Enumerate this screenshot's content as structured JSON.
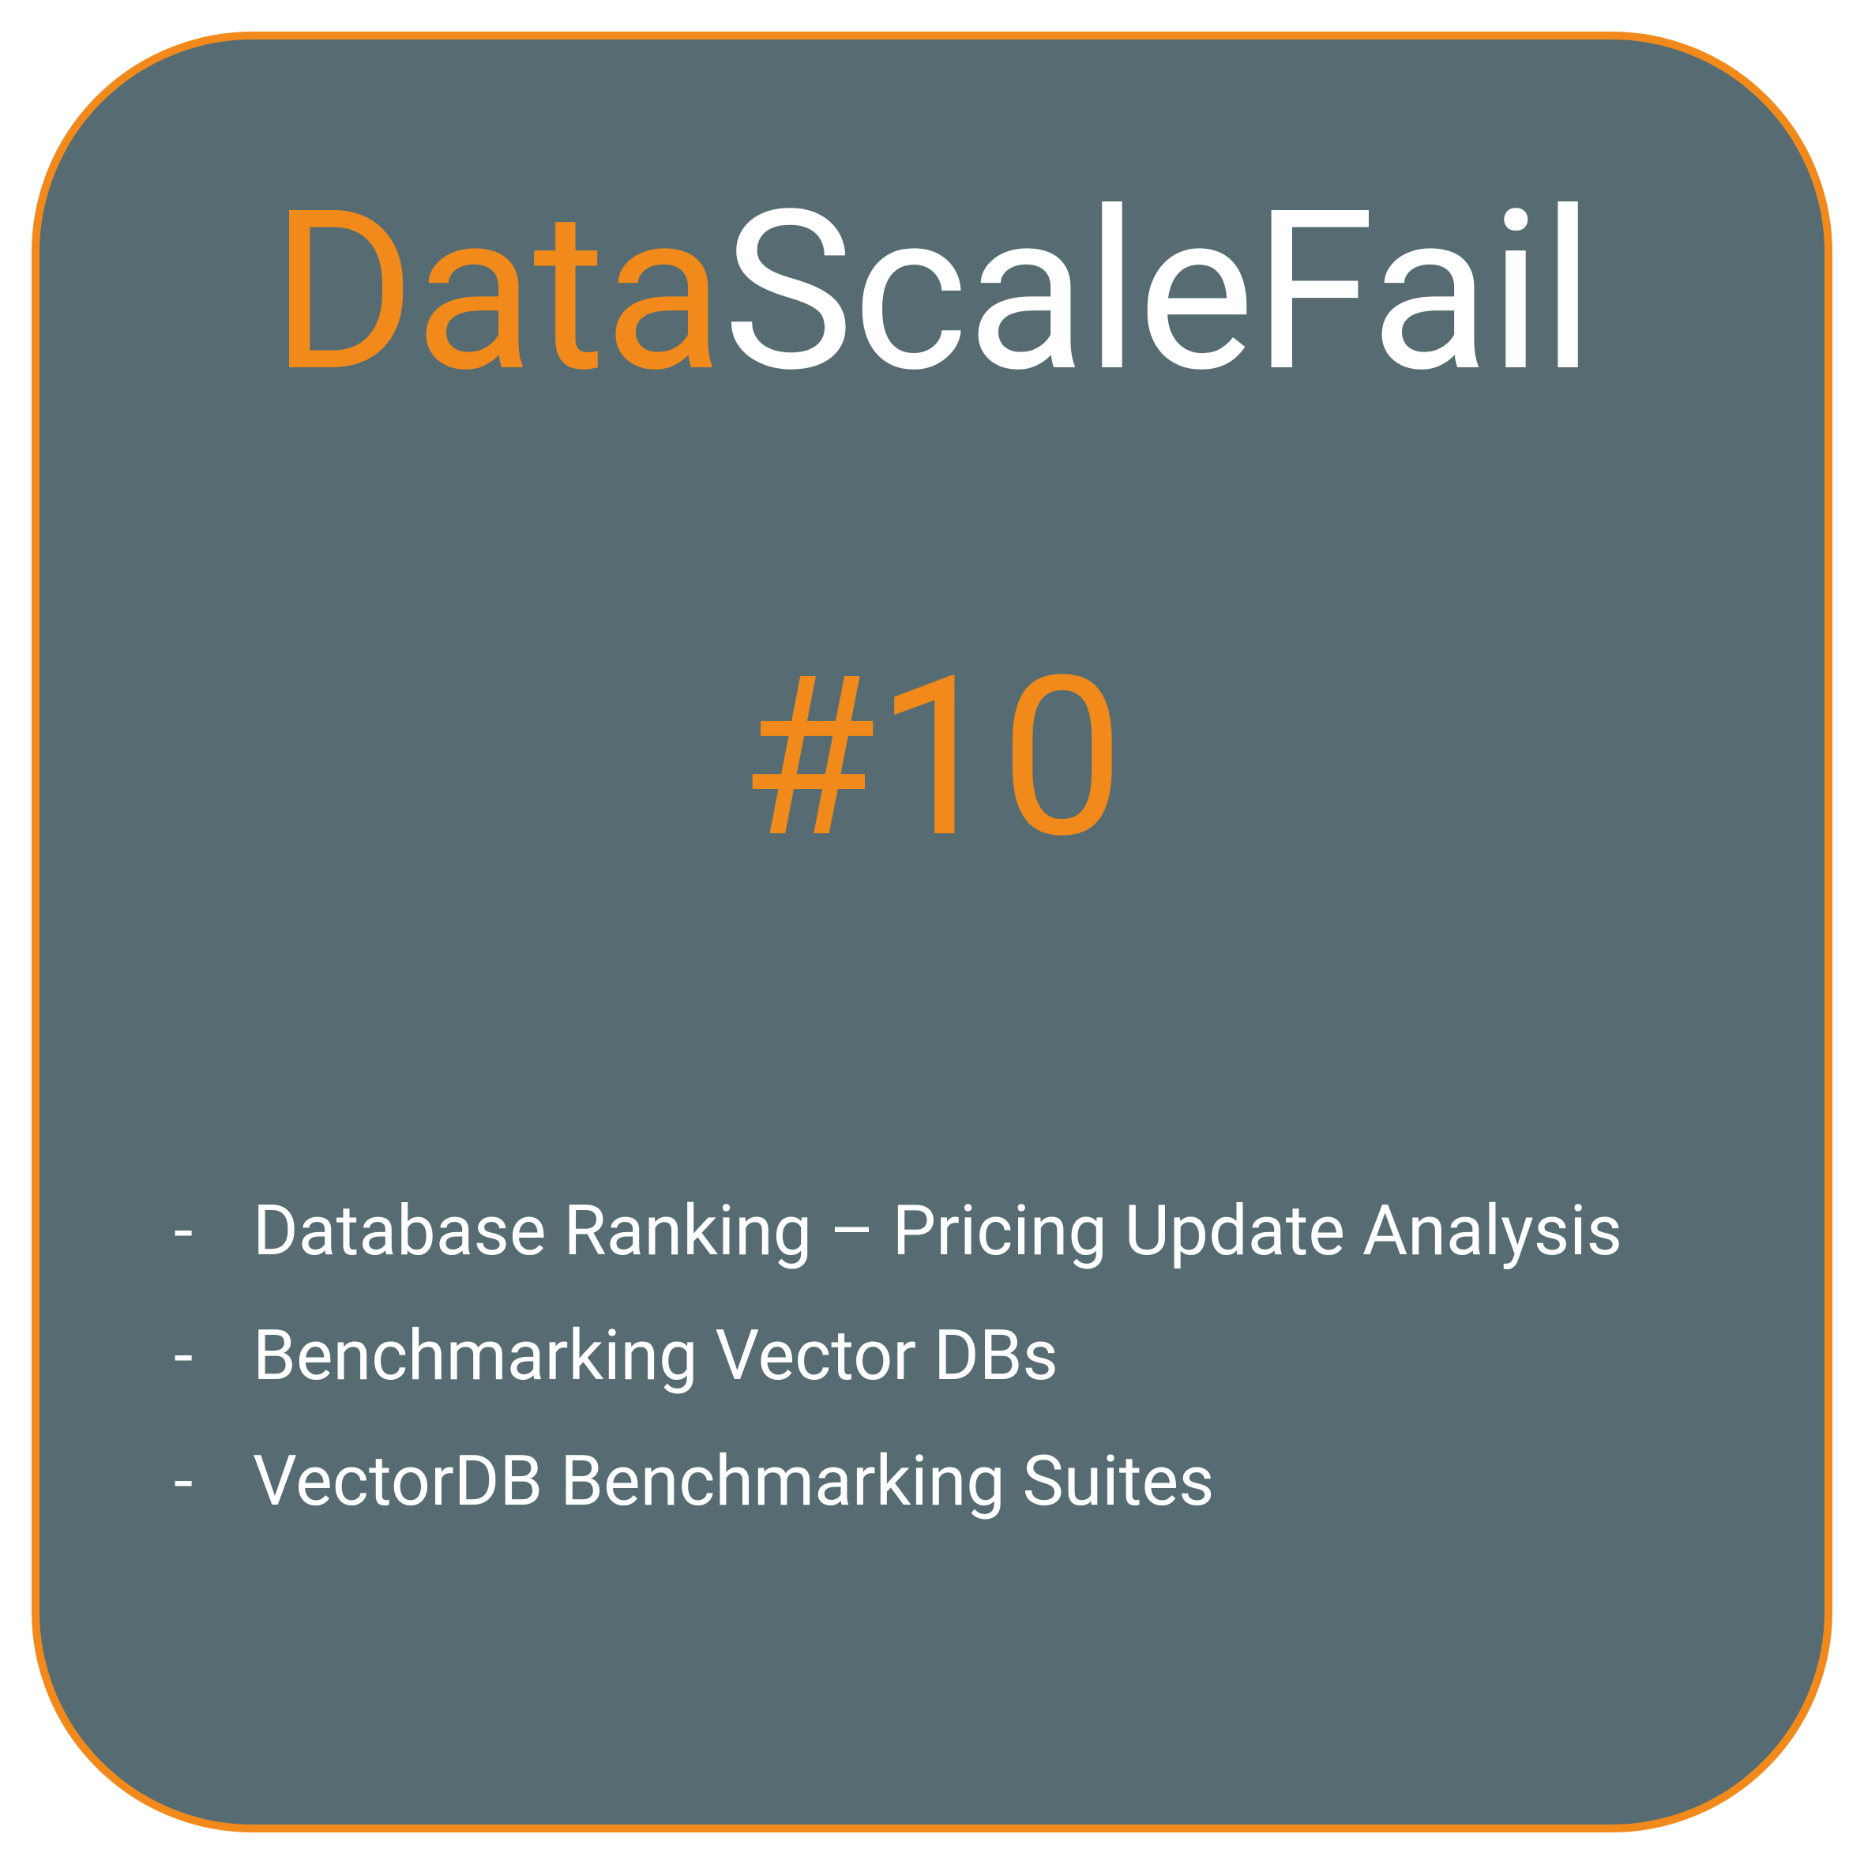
{
  "title": {
    "accent": "Data",
    "rest": "ScaleFail"
  },
  "issue": "#10",
  "bullets": [
    {
      "dash": "-",
      "text": "Database Ranking – Pricing Update Analysis"
    },
    {
      "dash": "-",
      "text": "Benchmarking Vector DBs"
    },
    {
      "dash": "-",
      "text": "VectorDB Benchmarking Suites"
    }
  ],
  "colors": {
    "accent": "#f18a1a",
    "background": "#566c72",
    "text": "#ffffff"
  }
}
